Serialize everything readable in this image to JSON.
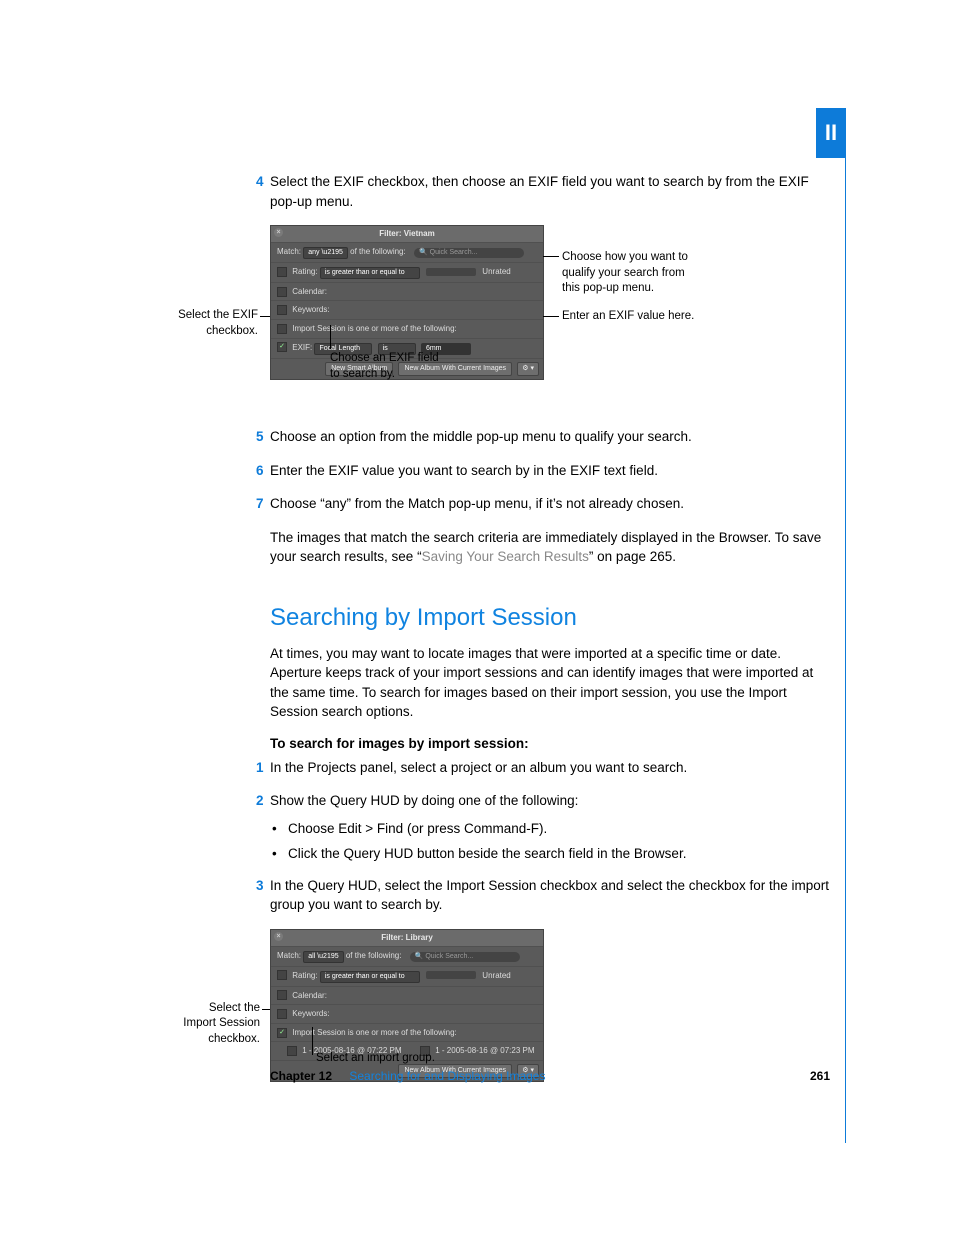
{
  "tab": "II",
  "steps_a": {
    "n4": "4",
    "t4": "Select the EXIF checkbox, then choose an EXIF field you want to search by from the EXIF pop-up menu.",
    "n5": "5",
    "t5": "Choose an option from the middle pop-up menu to qualify your search.",
    "n6": "6",
    "t6": "Enter the EXIF value you want to search by in the EXIF text field.",
    "n7": "7",
    "t7": "Choose “any” from the Match pop-up menu, if it’s not already chosen."
  },
  "result_text_a": "The images that match the search criteria are immediately displayed in the Browser. To save your search results, see “",
  "result_link": "Saving Your Search Results",
  "result_text_b": "” on page 265.",
  "heading": "Searching by Import Session",
  "intro": "At times, you may want to locate images that were imported at a specific time or date. Aperture keeps track of your import sessions and can identify images that were imported at the same time. To search for images based on their import session, you use the Import Session search options.",
  "subhead": "To search for images by import session:",
  "steps_b": {
    "n1": "1",
    "t1": "In the Projects panel, select a project or an album you want to search.",
    "n2": "2",
    "t2": "Show the Query HUD by doing one of the following:",
    "b1": "Choose Edit > Find (or press Command-F).",
    "b2": "Click the Query HUD button beside the search field in the Browser.",
    "n3": "3",
    "t3": "In the Query HUD, select the Import Session checkbox and select the checkbox for the import group you want to search by."
  },
  "hud1": {
    "title": "Filter: Vietnam",
    "match": "Match:",
    "any": "any",
    "ofthe": "of the following:",
    "quicksearch": "Quick Search...",
    "rating": "Rating:",
    "rating_op": "is greater than or equal to",
    "unrated": "Unrated",
    "calendar": "Calendar:",
    "keywords": "Keywords:",
    "importline": "Import Session is one or more of the following:",
    "exif": "EXIF:",
    "focal": "Focal Length",
    "is": "is",
    "val": "6mm",
    "btn_smart": "New Smart Album",
    "btn_album": "New Album With Current Images",
    "gear": "⚙ ▾"
  },
  "hud2": {
    "title": "Filter: Library",
    "match": "Match:",
    "all": "all",
    "ofthe": "of the following:",
    "quicksearch": "Quick Search...",
    "rating": "Rating:",
    "rating_op": "is greater than or equal to",
    "unrated": "Unrated",
    "calendar": "Calendar:",
    "keywords": "Keywords:",
    "importline": "Import Session is one or more of the following:",
    "sess1": "1 - 2005-08-16 @ 07:22 PM",
    "sess2": "1 - 2005-08-16 @ 07:23 PM",
    "btn_album": "New Album With Current Images",
    "gear": "⚙ ▾"
  },
  "callouts": {
    "exif_checkbox": "Select the EXIF checkbox.",
    "qualify1": "Choose how you want to",
    "qualify2": "qualify your search from",
    "qualify3": "this pop-up menu.",
    "exif_value": "Enter an EXIF value here.",
    "exif_field1": "Choose an EXIF field",
    "exif_field2": "to search by.",
    "import_cb1": "Select the",
    "import_cb2": "Import Session",
    "import_cb3": "checkbox.",
    "import_group": "Select an import group."
  },
  "footer": {
    "chapter": "Chapter 12",
    "title": "Searching for and Displaying Images",
    "page": "261"
  }
}
